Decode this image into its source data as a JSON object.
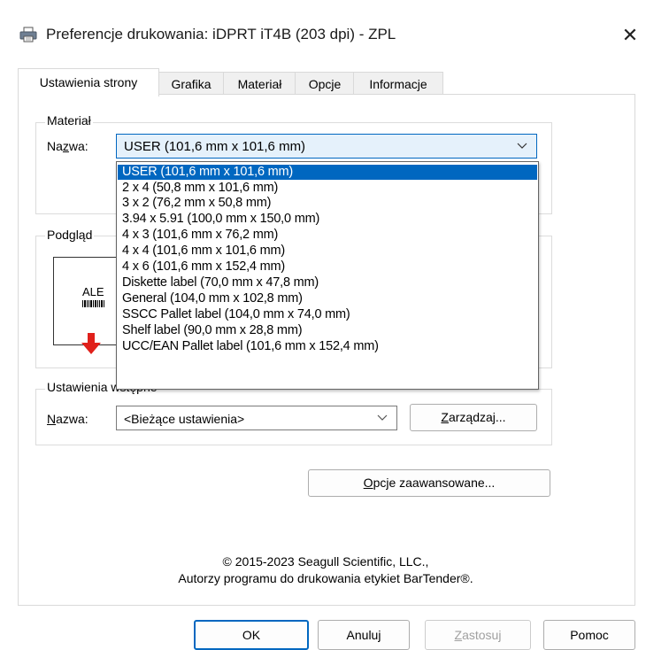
{
  "window": {
    "title": "Preferencje drukowania: iDPRT iT4B (203 dpi) - ZPL",
    "close_glyph": "✕"
  },
  "tabs": [
    {
      "label": "Ustawienia strony",
      "active": true
    },
    {
      "label": "Grafika",
      "active": false
    },
    {
      "label": "Materiał",
      "active": false
    },
    {
      "label": "Opcje",
      "active": false
    },
    {
      "label": "Informacje",
      "active": false
    }
  ],
  "material": {
    "group_label": "Materiał",
    "name_label_pre": "Na",
    "name_label_u": "z",
    "name_label_post": "wa:",
    "selected": "USER (101,6 mm x 101,6 mm)",
    "options": [
      "USER (101,6 mm x 101,6 mm)",
      "2 x 4 (50,8 mm x 101,6 mm)",
      "3 x 2 (76,2 mm x 50,8 mm)",
      "3.94 x 5.91 (100,0 mm x 150,0 mm)",
      "4 x 3 (101,6 mm x 76,2 mm)",
      "4 x 4 (101,6 mm x 101,6 mm)",
      "4 x 6 (101,6 mm x 152,4 mm)",
      "Diskette label (70,0 mm x 47,8 mm)",
      "General (104,0 mm x 102,8 mm)",
      "SSCC Pallet label (104,0 mm x 74,0 mm)",
      "Shelf label (90,0 mm x 28,8 mm)",
      "UCC/EAN Pallet label (101,6 mm x 152,4 mm)"
    ]
  },
  "preview": {
    "group_label": "Podgląd",
    "sample_text": "ALE"
  },
  "presets": {
    "group_label": "Ustawienia wstępne",
    "name_label_u": "N",
    "name_label_post": "azwa:",
    "value": "<Bieżące ustawienia>",
    "manage_u": "Z",
    "manage_post": "arządzaj..."
  },
  "advanced": {
    "label_u": "O",
    "label_post": "pcje zaawansowane..."
  },
  "footer": {
    "copyright": "© 2015-2023 Seagull Scientific, LLC.,",
    "authors": "Autorzy programu do drukowania etykiet BarTender®."
  },
  "buttons": {
    "ok": "OK",
    "cancel": "Anuluj",
    "apply_u": "Z",
    "apply_post": "astosuj",
    "help": "Pomoc"
  },
  "colors": {
    "accent": "#0067c0",
    "arrow": "#e0201b"
  }
}
